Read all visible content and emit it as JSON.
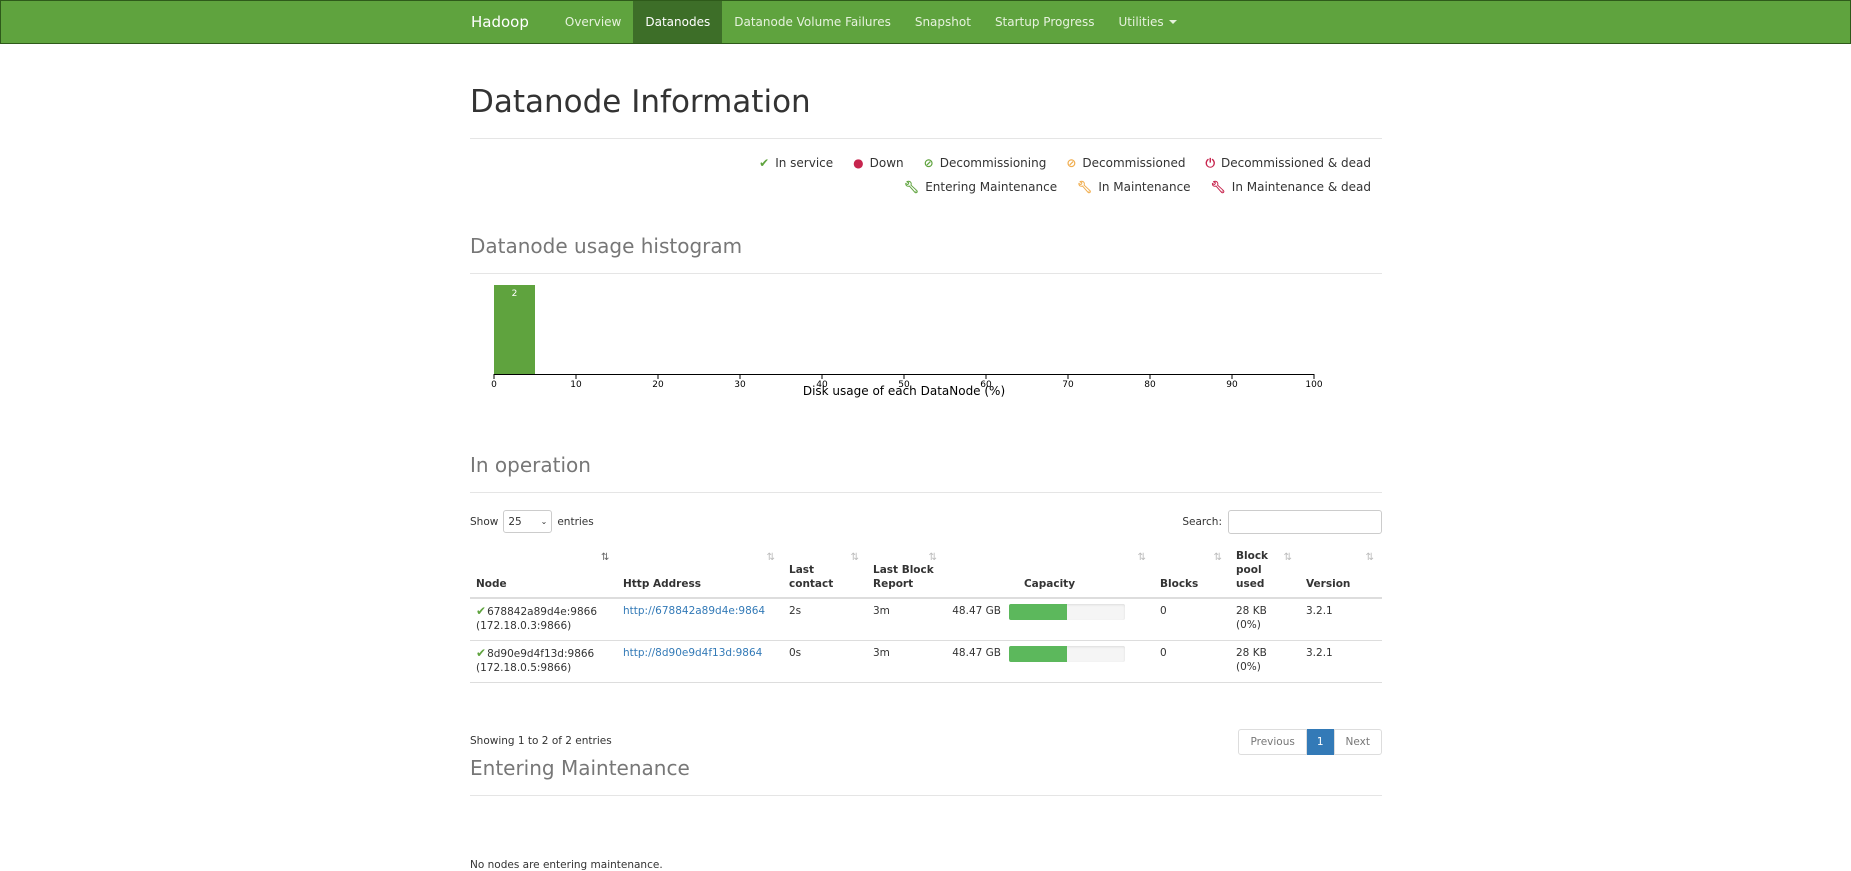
{
  "navbar": {
    "brand": "Hadoop",
    "items": [
      {
        "label": "Overview"
      },
      {
        "label": "Datanodes"
      },
      {
        "label": "Datanode Volume Failures"
      },
      {
        "label": "Snapshot"
      },
      {
        "label": "Startup Progress"
      },
      {
        "label": "Utilities"
      }
    ],
    "active": "Datanodes"
  },
  "page_title": "Datanode Information",
  "legend": {
    "in_service": "In service",
    "down": "Down",
    "decommissioning": "Decommissioning",
    "decommissioned": "Decommissioned",
    "decommissioned_dead": "Decommissioned & dead",
    "entering_maintenance": "Entering Maintenance",
    "in_maintenance": "In Maintenance",
    "in_maintenance_dead": "In Maintenance & dead"
  },
  "histogram": {
    "heading": "Datanode usage histogram",
    "chart_data": {
      "type": "bar",
      "bins": [
        {
          "x0": 0,
          "x1": 5,
          "count": 2
        }
      ],
      "xlim": [
        0,
        100
      ],
      "ticks": [
        "0",
        "10",
        "20",
        "30",
        "40",
        "50",
        "60",
        "70",
        "80",
        "90",
        "100"
      ],
      "xlabel": "Disk usage of each DataNode (%)"
    }
  },
  "in_operation": {
    "heading": "In operation",
    "show_label": "Show",
    "page_length": "25",
    "entries_label": "entries",
    "search_label": "Search:",
    "columns": {
      "node": "Node",
      "http": "Http Address",
      "last_contact": "Last contact",
      "last_block_report": "Last Block Report",
      "capacity": "Capacity",
      "blocks": "Blocks",
      "block_pool_used": "Block pool used",
      "version": "Version"
    },
    "rows": [
      {
        "node": "678842a89d4e:9866",
        "node_ip": "(172.18.0.3:9866)",
        "http": "http://678842a89d4e:9864",
        "last_contact": "2s",
        "last_block_report": "3m",
        "capacity": "48.47 GB",
        "capacity_used_pct": 50,
        "blocks": "0",
        "block_pool_used": "28 KB (0%)",
        "version": "3.2.1"
      },
      {
        "node": "8d90e9d4f13d:9866",
        "node_ip": "(172.18.0.5:9866)",
        "http": "http://8d90e9d4f13d:9864",
        "last_contact": "0s",
        "last_block_report": "3m",
        "capacity": "48.47 GB",
        "capacity_used_pct": 50,
        "blocks": "0",
        "block_pool_used": "28 KB (0%)",
        "version": "3.2.1"
      }
    ],
    "info": "Showing 1 to 2 of 2 entries",
    "pager": {
      "previous": "Previous",
      "current": "1",
      "next": "Next"
    }
  },
  "entering_maintenance": {
    "heading": "Entering Maintenance",
    "empty_text": "No nodes are entering maintenance."
  },
  "colors": {
    "navbar": "#5fa33e",
    "navbar_active": "#3d6e28",
    "bar": "#5fa33e",
    "progress": "#5cb85c",
    "link": "#337ab7"
  }
}
